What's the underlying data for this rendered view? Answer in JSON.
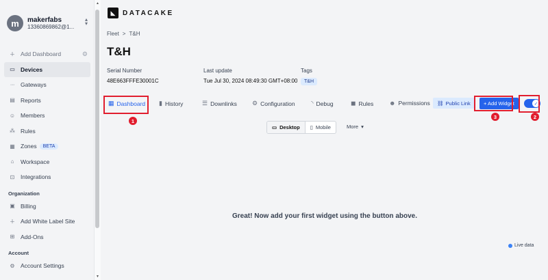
{
  "user": {
    "initial": "m",
    "name": "makerfabs",
    "email": "13360869862@1..."
  },
  "sidebar": {
    "items": [
      {
        "label": "Add Dashboard",
        "icon": "plus-icon"
      },
      {
        "label": "Devices",
        "icon": "device-icon"
      },
      {
        "label": "Gateways",
        "icon": "gateway-icon"
      },
      {
        "label": "Reports",
        "icon": "report-icon"
      },
      {
        "label": "Members",
        "icon": "members-icon"
      },
      {
        "label": "Rules",
        "icon": "rules-icon"
      },
      {
        "label": "Zones",
        "icon": "map-icon",
        "badge": "BETA"
      },
      {
        "label": "Workspace",
        "icon": "workspace-icon"
      },
      {
        "label": "Integrations",
        "icon": "integrations-icon"
      }
    ],
    "org_section": "Organization",
    "org_items": [
      {
        "label": "Billing",
        "icon": "billing-icon"
      },
      {
        "label": "Add White Label Site",
        "icon": "plus-icon"
      },
      {
        "label": "Add-Ons",
        "icon": "addons-icon"
      }
    ],
    "account_section": "Account",
    "account_items": [
      {
        "label": "Account Settings",
        "icon": "gear-icon"
      }
    ]
  },
  "brand": {
    "name": "DATACAKE"
  },
  "breadcrumb": {
    "root": "Fleet",
    "separator": ">",
    "current": "T&H"
  },
  "device": {
    "title": "T&H",
    "serial_label": "Serial Number",
    "serial_value": "48E663FFFE30001C",
    "update_label": "Last update",
    "update_value": "Tue Jul 30, 2024 08:49:30 GMT+08:00",
    "tags_label": "Tags",
    "tag": "T&H"
  },
  "tabs": [
    {
      "label": "Dashboard",
      "icon": "table-icon"
    },
    {
      "label": "History",
      "icon": "bar-chart-icon"
    },
    {
      "label": "Downlinks",
      "icon": "sliders-icon"
    },
    {
      "label": "Configuration",
      "icon": "gear-icon"
    },
    {
      "label": "Debug",
      "icon": "wifi-icon"
    },
    {
      "label": "Rules",
      "icon": "chat-icon"
    },
    {
      "label": "Permissions",
      "icon": "users-icon"
    }
  ],
  "actions": {
    "public_link": "Public Link",
    "add_widget": "+ Add Widget"
  },
  "markers": [
    "1",
    "2",
    "3"
  ],
  "view": {
    "desktop": "Desktop",
    "mobile": "Mobile",
    "more": "More"
  },
  "empty_message": "Great! Now add your first widget using the button above.",
  "live_data": "Live data",
  "colors": {
    "accent": "#2563eb",
    "highlight": "#e11d2e"
  }
}
